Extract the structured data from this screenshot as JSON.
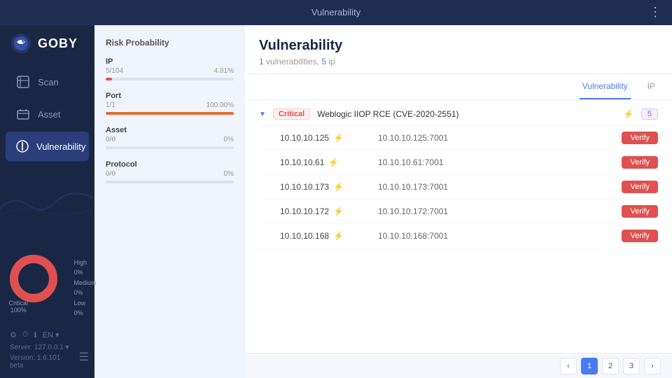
{
  "topbar": {
    "title": "Vulnerability",
    "menu_icon": "⋮"
  },
  "sidebar": {
    "logo_text": "GOBY",
    "nav_items": [
      {
        "id": "scan",
        "label": "Scan",
        "icon": "scan"
      },
      {
        "id": "asset",
        "label": "Asset",
        "icon": "asset"
      },
      {
        "id": "vulnerability",
        "label": "Vulnerability",
        "icon": "vuln",
        "active": true
      }
    ],
    "bottom": {
      "server_label": "Server: 127.0.0.1 ▾",
      "version_label": "Version: 1.6.101 beta",
      "lang": "EN ▾"
    },
    "chart": {
      "legend": [
        {
          "label": "High",
          "value": "0%"
        },
        {
          "label": "Medium",
          "value": "0%"
        },
        {
          "label": "Low",
          "value": "0%"
        }
      ],
      "critical_label": "Critical",
      "critical_value": "100%"
    }
  },
  "risk_panel": {
    "title": "Risk Probability",
    "sections": [
      {
        "id": "ip",
        "label": "IP",
        "sublabel_left": "5/104",
        "sublabel_right": "4.81%",
        "bar_pct": 5,
        "bar_color": "red"
      },
      {
        "id": "port",
        "label": "Port",
        "sublabel_left": "1/1",
        "sublabel_right": "100.00%",
        "bar_pct": 100,
        "bar_color": "orange"
      },
      {
        "id": "asset",
        "label": "Asset",
        "sublabel_left": "0/0",
        "sublabel_right": "0%",
        "bar_pct": 0,
        "bar_color": "red"
      },
      {
        "id": "protocol",
        "label": "Protocol",
        "sublabel_left": "0/0",
        "sublabel_right": "0%",
        "bar_pct": 0,
        "bar_color": "red"
      }
    ]
  },
  "vulnerability_panel": {
    "title": "Vulnerability",
    "subtitle_vuln_count": "1",
    "subtitle_vuln_label": "vulnerabilities,",
    "subtitle_ip_count": "5",
    "subtitle_ip_label": "ip",
    "tabs": [
      {
        "id": "vulnerability",
        "label": "Vulnerability",
        "active": true
      },
      {
        "id": "ip",
        "label": "IP",
        "active": false
      }
    ],
    "groups": [
      {
        "severity": "Critical",
        "vuln_name": "Weblogic IIOP RCE (CVE-2020-2551)",
        "has_flash": true,
        "count": "5",
        "rows": [
          {
            "ip": "10.10.10.125",
            "has_flash": true,
            "port_info": "10.10.10.125:7001",
            "verify_label": "Verify"
          },
          {
            "ip": "10.10.10.61",
            "has_flash": true,
            "port_info": "10.10.10.61:7001",
            "verify_label": "Verify"
          },
          {
            "ip": "10.10.10.173",
            "has_flash": true,
            "port_info": "10.10.10.173:7001",
            "verify_label": "Verify"
          },
          {
            "ip": "10.10.10.172",
            "has_flash": true,
            "port_info": "10.10.10.172:7001",
            "verify_label": "Verify"
          },
          {
            "ip": "10.10.10.168",
            "has_flash": true,
            "port_info": "10.10.10.168:7001",
            "verify_label": "Verify"
          }
        ]
      }
    ],
    "bottom_bar": {
      "page_info": "",
      "pages": [
        "1",
        "2",
        "3"
      ]
    }
  }
}
